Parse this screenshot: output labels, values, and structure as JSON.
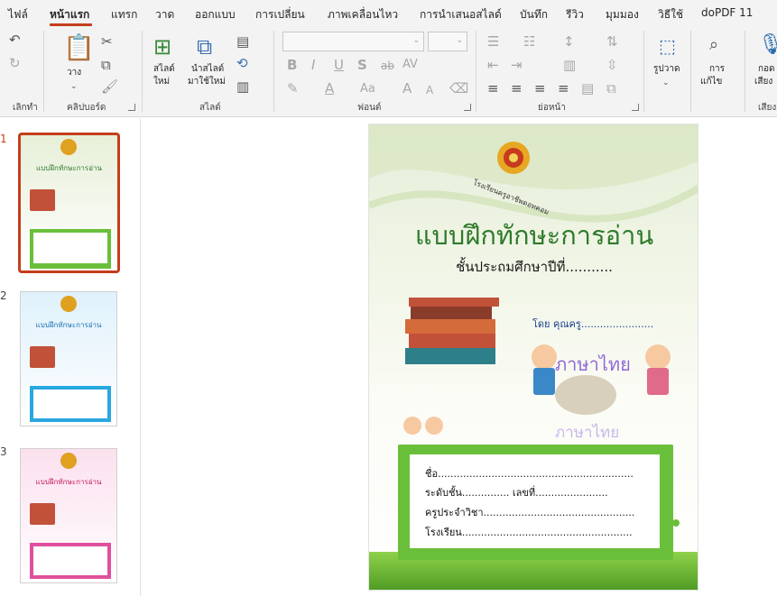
{
  "ribbon_tabs": [
    {
      "label": "ไฟล์"
    },
    {
      "label": "หน้าแรก"
    },
    {
      "label": "แทรก"
    },
    {
      "label": "วาด"
    },
    {
      "label": "ออกแบบ"
    },
    {
      "label": "การเปลี่ยน"
    },
    {
      "label": "ภาพเคลื่อนไหว"
    },
    {
      "label": "การนำเสนอสไลด์"
    },
    {
      "label": "บันทึก"
    },
    {
      "label": "รีวิว"
    },
    {
      "label": "มุมมอง"
    },
    {
      "label": "วิธีใช้"
    },
    {
      "label": "doPDF 11"
    }
  ],
  "ribbon": {
    "undo_group": "เลิกทำ",
    "clipboard": {
      "paste": "วาง",
      "group": "คลิปบอร์ด"
    },
    "slides": {
      "new_slide_1": "สไลด์",
      "new_slide_2": "ใหม่",
      "reuse_1": "นำสไลด์",
      "reuse_2": "มาใช้ใหม่",
      "group": "สไลด์"
    },
    "font": {
      "group": "ฟอนต์",
      "bold": "B",
      "italic": "I",
      "underline": "U",
      "shadow": "S",
      "strike": "ab",
      "spacing": "AV",
      "case": "Aa",
      "grow": "A",
      "shrink": "A"
    },
    "paragraph": {
      "group": "ย่อหน้า"
    },
    "drawing": {
      "label": "รูปวาด"
    },
    "editing": {
      "label_1": "การ",
      "label_2": "แก้ไข"
    },
    "voice": {
      "label_1": "กอด",
      "label_2": "เสียง",
      "group": "เสียง"
    }
  },
  "thumbnails": [
    {
      "number": "1",
      "title": "แบบฝึกทักษะการอ่าน",
      "theme": "#6abf3a",
      "selected": true
    },
    {
      "number": "2",
      "title": "แบบฝึกทักษะการอ่าน",
      "theme": "#29a7e0",
      "selected": false
    },
    {
      "number": "3",
      "title": "แบบฝึกทักษะการอ่าน",
      "theme": "#e0509e",
      "selected": false
    }
  ],
  "slide": {
    "school_name": "โรงเรียนครูอาชีพดอทคอม",
    "title": "แบบฝึกทักษะการอ่าน",
    "subtitle": "ชั้นประถมศึกษาปีที่...........",
    "byline": "โดย  คุณครู.......................",
    "art_text_1": "ภาษาไทย",
    "art_text_2": "ภาษาไทย",
    "form": {
      "name": "ชื่อ..............................................................",
      "level": "ระดับชั้น...............  เลขที่.......................",
      "teacher": "ครูประจำวิชา................................................",
      "school": "โรงเรียน......................................................"
    }
  },
  "colors": {
    "accent": "#c43e1c",
    "title_green": "#2f7a2a",
    "box_green": "#6abf3a"
  }
}
